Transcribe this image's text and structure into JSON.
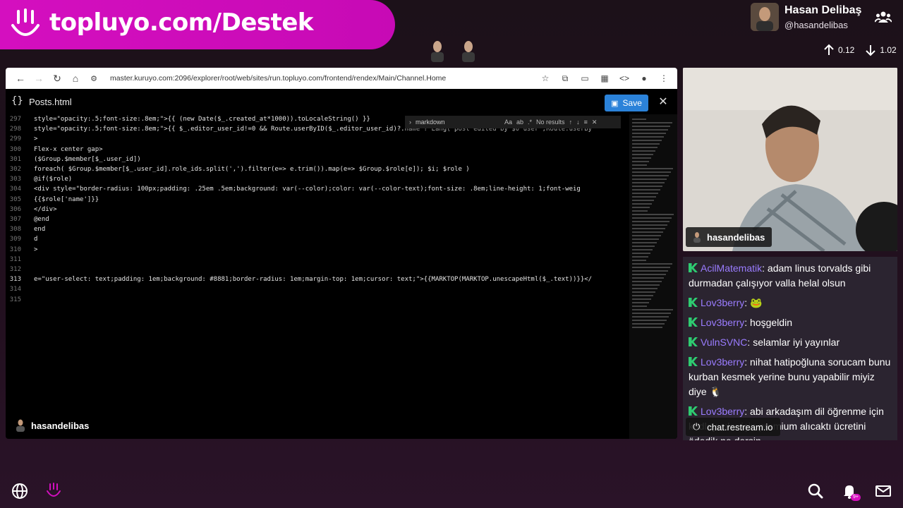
{
  "brand": {
    "text": "topluyo.com/Destek"
  },
  "user": {
    "name": "Hasan Delibaş",
    "handle": "@hasandelibas"
  },
  "stats": {
    "up": "0.12",
    "down": "1.02"
  },
  "browser": {
    "url": "master.kuruyo.com:2096/explorer/root/web/sites/run.topluyo.com/frontend/rendex/Main/Channel.Home"
  },
  "editor": {
    "file_name": "Posts.html",
    "save_label": "Save",
    "find": {
      "query": "markdown",
      "case": "Aa",
      "word": "ab",
      "regex": ".*",
      "result": "No results"
    },
    "lines": [
      {
        "num": "297",
        "code": "style=\"opacity:.5;font-size:.8em;\">{{ (new Date($_.created_at*1000)).toLocaleString() }}"
      },
      {
        "num": "298",
        "code": "style=\"opacity:.5;font-size:.8em;\">{{ $_.editor_user_id!=0 && Route.userByID($_.editor_user_id)?.name ? Lang('post edited by $0 user',Route.userBy"
      },
      {
        "num": "299",
        "code": ">"
      },
      {
        "num": "300",
        "code": "Flex-x center gap>"
      },
      {
        "num": "301",
        "code": "($Group.$member[$_.user_id])"
      },
      {
        "num": "302",
        "code": "foreach( $Group.$member[$_.user_id].role_ids.split(',').filter(e=> e.trim()).map(e=> $Group.$role[e]); $i; $role )"
      },
      {
        "num": "303",
        "code": " @if($role)"
      },
      {
        "num": "304",
        "code": "   <div style=\"border-radius: 100px;padding: .25em .5em;background: var(--color);color: var(--color-text);font-size: .8em;line-height: 1;font-weig"
      },
      {
        "num": "305",
        "code": "     {{$role['name']}}"
      },
      {
        "num": "306",
        "code": "   </div>"
      },
      {
        "num": "307",
        "code": " @end"
      },
      {
        "num": "308",
        "code": "end"
      },
      {
        "num": "309",
        "code": "d"
      },
      {
        "num": "310",
        "code": ">"
      },
      {
        "num": "311",
        "code": ""
      },
      {
        "num": "312",
        "code": ""
      },
      {
        "num": "313",
        "code": "e=\"user-select: text;padding: 1em;background: #8881;border-radius: 1em;margin-top: 1em;cursor: text;\">{{MARKTOP(MARKTOP.unescapeHtml($_.text))}}</"
      },
      {
        "num": "314",
        "code": ""
      },
      {
        "num": "315",
        "code": ""
      }
    ],
    "footer_user": "hasandelibas"
  },
  "cam": {
    "label": "hasandelibas"
  },
  "chat": {
    "messages": [
      {
        "user": "AcilMatematik",
        "text": "adam linus torvalds gibi durmadan çalışıyor valla helal olsun"
      },
      {
        "user": "Lov3berry",
        "text": "🐸"
      },
      {
        "user": "Lov3berry",
        "text": "hoşgeldin"
      },
      {
        "user": "VulnSVNC",
        "text": "selamlar iyi yayınlar"
      },
      {
        "user": "Lov3berry",
        "text": "nihat hatipoğluna sorucam bunu kurban kesmek yerine bunu yapabilir miyiz diye 🐧"
      },
      {
        "user": "Lov3berry",
        "text": "abi arkadaşım dil öğrenme için kodlayıcılar için premium alıcaktı ücretini ödedik ne dersin"
      }
    ],
    "source": "chat.restream.io"
  },
  "notifications": {
    "badge": "9+"
  },
  "colors": {
    "brand": "#d40fbf",
    "accent": "#2b82d9",
    "chat_user": "#9a7cff",
    "chat_icon": "#2ecc71"
  }
}
